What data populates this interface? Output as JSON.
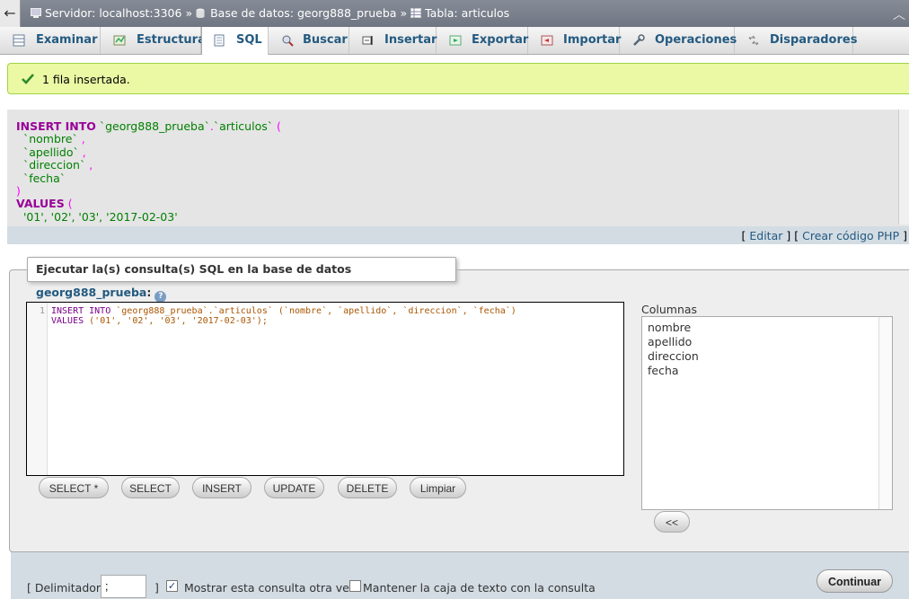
{
  "breadcrumb": {
    "server": "Servidor: localhost:3306",
    "database": "Base de datos: georg888_prueba",
    "table": "Tabla: articulos",
    "separator": "»"
  },
  "tabs": [
    {
      "label": "Examinar",
      "icon": "browse-icon"
    },
    {
      "label": "Estructura",
      "icon": "structure-icon"
    },
    {
      "label": "SQL",
      "icon": "sql-icon",
      "active": true
    },
    {
      "label": "Buscar",
      "icon": "search-icon"
    },
    {
      "label": "Insertar",
      "icon": "insert-icon"
    },
    {
      "label": "Exportar",
      "icon": "export-icon"
    },
    {
      "label": "Importar",
      "icon": "import-icon"
    },
    {
      "label": "Operaciones",
      "icon": "wrench-icon"
    },
    {
      "label": "Disparadores",
      "icon": "triggers-icon"
    }
  ],
  "success_message": "1 fila insertada.",
  "sql_display": {
    "line1_kw": "INSERT INTO",
    "line1_db": "`georg888_prueba`",
    "line1_dot": ".",
    "line1_table": "`articulos`",
    "line1_paren": "(",
    "col1": "`nombre`",
    "col2": "`apellido`",
    "col3": "`direccion`",
    "col4": "`fecha`",
    "comma": ",",
    "close_paren": ")",
    "values_kw": "VALUES",
    "open_paren": "(",
    "values": "'01', '02', '03', '2017-02-03'",
    "edit_link": "Editar",
    "php_link": "Crear código PHP",
    "open_bracket": "[",
    "close_bracket": "]"
  },
  "query_panel": {
    "legend_prefix": "Ejecutar la(s) consulta(s) SQL en la base de datos",
    "database": "georg888_prueba",
    "colon": ":",
    "help_glyph": "?",
    "line_number": "1",
    "editor_line1_kw": "INSERT INTO",
    "editor_line1_rest": "`georg888_prueba`.`articulos`",
    "editor_line1_cols": "(`nombre`, `apellido`, `direccion`, `fecha`)",
    "editor_line2_kw": "VALUES",
    "editor_line2_rest": "('01', '02', '03', '2017-02-03');",
    "buttons": [
      "SELECT *",
      "SELECT",
      "INSERT",
      "UPDATE",
      "DELETE",
      "Limpiar"
    ],
    "columns_label": "Columnas",
    "columns": [
      "nombre",
      "apellido",
      "direccion",
      "fecha"
    ],
    "insert_column_button": "<<"
  },
  "bottom": {
    "delimiter_open": "[ Delimitador",
    "delimiter_value": ";",
    "delimiter_close": "]",
    "show_query_label": "Mostrar esta consulta otra vez",
    "show_query_checked": true,
    "keep_box_label": "Mantener la caja de texto con la consulta",
    "keep_box_checked": false,
    "continue_button": "Continuar"
  },
  "colors": {
    "link": "#235a81",
    "success_bg": "#ebf8a4",
    "keyword": "#990099",
    "string": "#008000"
  }
}
